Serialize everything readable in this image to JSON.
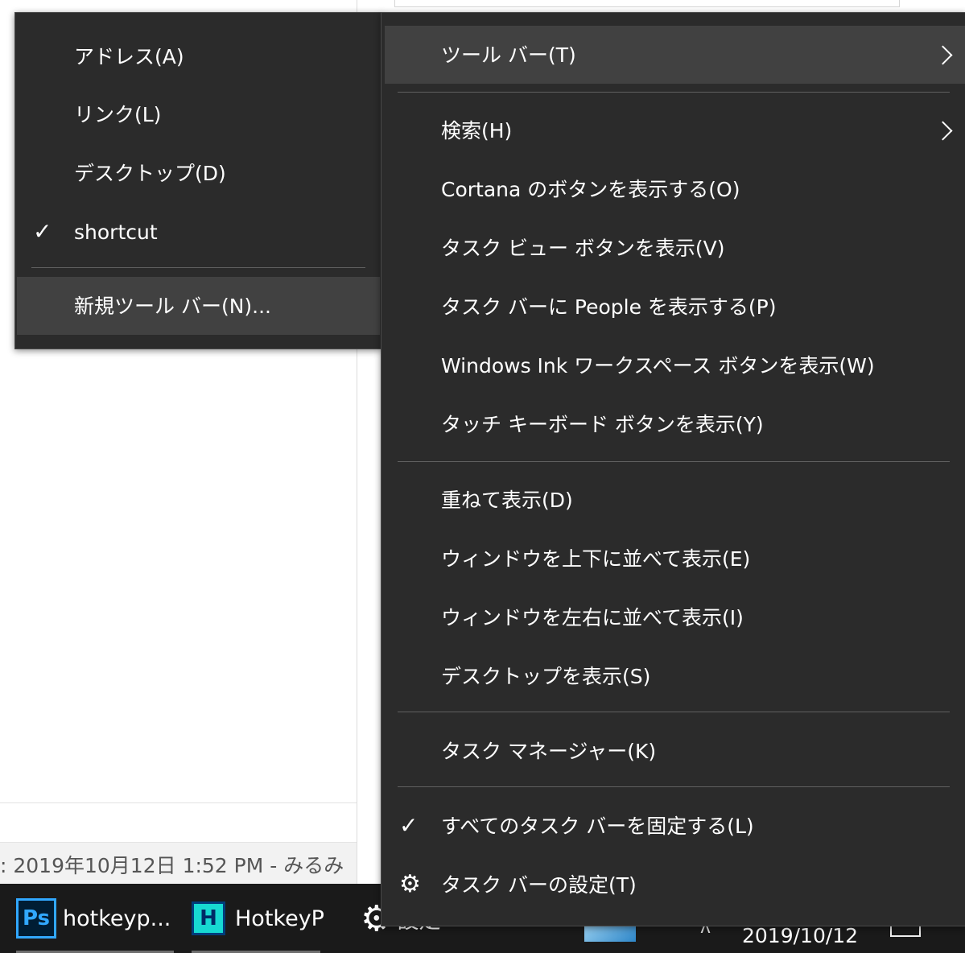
{
  "background": {
    "status_text": ": 2019年10月12日 1:52 PM - みるみ"
  },
  "submenu": {
    "items": [
      {
        "label": "アドレス(A)"
      },
      {
        "label": "リンク(L)"
      },
      {
        "label": "デスクトップ(D)"
      },
      {
        "label": "shortcut",
        "checked": true
      },
      {
        "label": "新規ツール バー(N)..."
      }
    ]
  },
  "context_menu": {
    "items": [
      {
        "label": "ツール バー(T)"
      },
      {
        "label": "検索(H)"
      },
      {
        "label": "Cortana のボタンを表示する(O)"
      },
      {
        "label": "タスク ビュー ボタンを表示(V)"
      },
      {
        "label": "タスク バーに People を表示する(P)"
      },
      {
        "label": "Windows Ink ワークスペース ボタンを表示(W)"
      },
      {
        "label": "タッチ キーボード ボタンを表示(Y)"
      },
      {
        "label": "重ねて表示(D)"
      },
      {
        "label": "ウィンドウを上下に並べて表示(E)"
      },
      {
        "label": "ウィンドウを左右に並べて表示(I)"
      },
      {
        "label": "デスクトップを表示(S)"
      },
      {
        "label": "タスク マネージャー(K)"
      },
      {
        "label": "すべてのタスク バーを固定する(L)",
        "checked": true
      },
      {
        "label": "タスク バーの設定(T)",
        "icon": "gear-icon"
      }
    ]
  },
  "taskbar": {
    "apps": [
      {
        "icon_text": "Ps",
        "label": "hotkeyp..."
      },
      {
        "icon_text": "H",
        "label": "HotkeyP"
      },
      {
        "icon": "gear-icon",
        "label": "設定"
      }
    ],
    "clock_date": "2019/10/12"
  },
  "colors": {
    "menu_bg": "#2b2b2b",
    "menu_highlight": "#414141",
    "separator": "#606060",
    "taskbar_bg": "#1a1a1a"
  }
}
